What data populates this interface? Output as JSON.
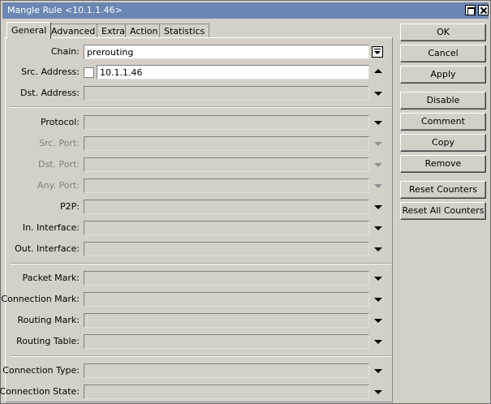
{
  "window": {
    "title": "Mangle Rule <10.1.1.46>"
  },
  "tabs": [
    "General",
    "Advanced",
    "Extra",
    "Action",
    "Statistics"
  ],
  "form": {
    "chain": {
      "label": "Chain:",
      "value": "prerouting"
    },
    "src_address": {
      "label": "Src. Address:",
      "value": "10.1.1.46",
      "negate_checked": false
    },
    "dst_address": {
      "label": "Dst. Address:",
      "value": ""
    },
    "protocol": {
      "label": "Protocol:",
      "value": ""
    },
    "src_port": {
      "label": "Src. Port:",
      "value": ""
    },
    "dst_port": {
      "label": "Dst. Port:",
      "value": ""
    },
    "any_port": {
      "label": "Any. Port:",
      "value": ""
    },
    "p2p": {
      "label": "P2P:",
      "value": ""
    },
    "in_interface": {
      "label": "In. Interface:",
      "value": ""
    },
    "out_interface": {
      "label": "Out. Interface:",
      "value": ""
    },
    "packet_mark": {
      "label": "Packet Mark:",
      "value": ""
    },
    "connection_mark": {
      "label": "Connection Mark:",
      "value": ""
    },
    "routing_mark": {
      "label": "Routing Mark:",
      "value": ""
    },
    "routing_table": {
      "label": "Routing Table:",
      "value": ""
    },
    "connection_type": {
      "label": "Connection Type:",
      "value": ""
    },
    "connection_state": {
      "label": "Connection State:",
      "value": ""
    }
  },
  "buttons": {
    "ok": "OK",
    "cancel": "Cancel",
    "apply": "Apply",
    "disable": "Disable",
    "comment": "Comment",
    "copy": "Copy",
    "remove": "Remove",
    "reset_counters": "Reset Counters",
    "reset_all_counters": "Reset All Counters"
  }
}
